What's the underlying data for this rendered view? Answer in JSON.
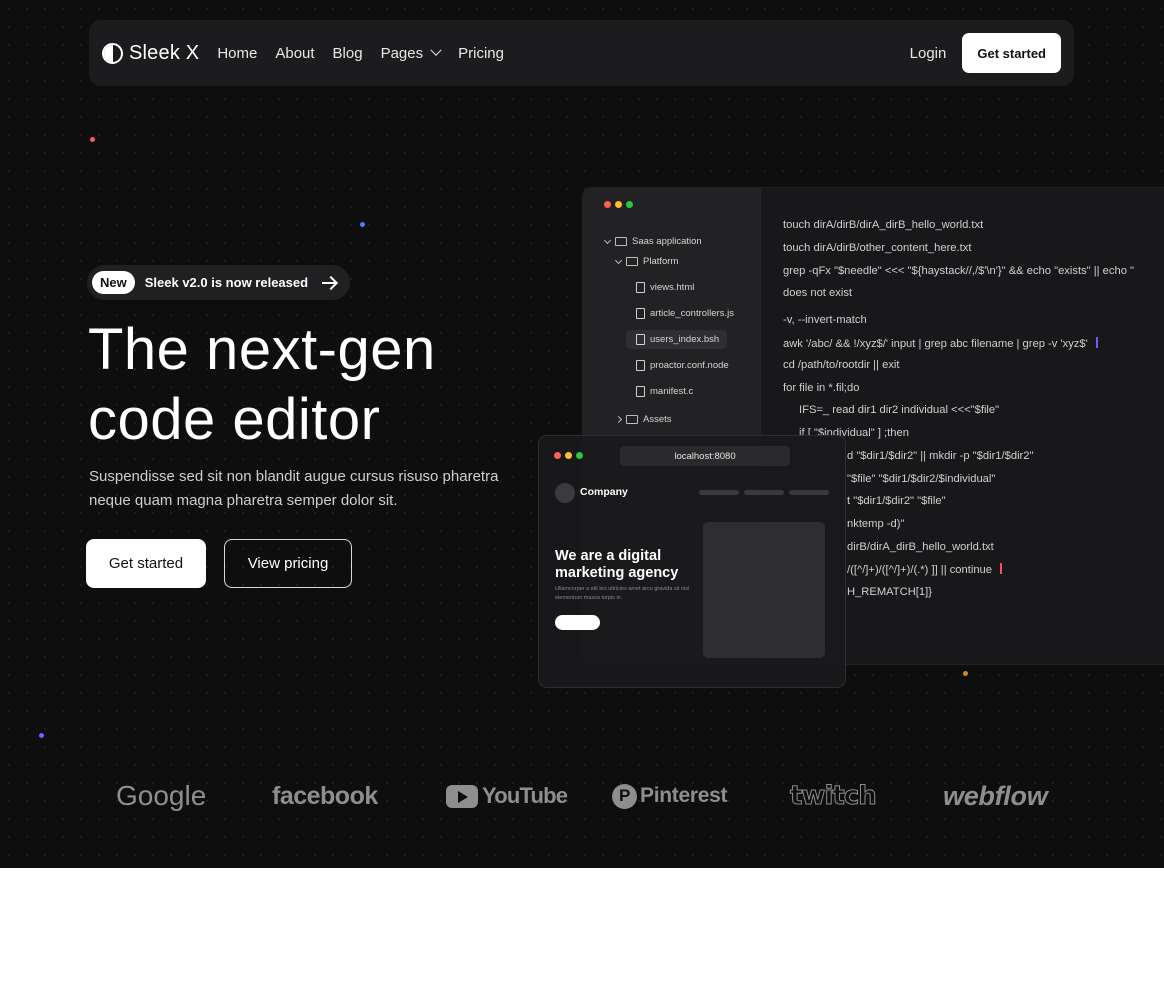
{
  "nav": {
    "logo_text": "Sleek X",
    "links": [
      {
        "label": "Home"
      },
      {
        "label": "About"
      },
      {
        "label": "Blog"
      },
      {
        "label": "Pages"
      },
      {
        "label": "Pricing"
      }
    ],
    "login_label": "Login",
    "cta_label": "Get started"
  },
  "hero": {
    "badge_pill": "New",
    "badge_text": "Sleek v2.0 is now released",
    "headline_line1": "The next-gen",
    "headline_line2": "code editor",
    "subtext": "Suspendisse sed sit non blandit augue cursus risuso pharetra neque quam magna pharetra semper dolor sit.",
    "primary_button": "Get started",
    "secondary_button": "View pricing"
  },
  "editor": {
    "tree": [
      {
        "label": "Saas application",
        "type": "folder"
      },
      {
        "label": "Platform",
        "type": "folder"
      },
      {
        "label": "views.html",
        "type": "file"
      },
      {
        "label": "article_controllers.js",
        "type": "file"
      },
      {
        "label": "users_index.bsh",
        "type": "file",
        "selected": true
      },
      {
        "label": "proactor.conf.node",
        "type": "file"
      },
      {
        "label": "manifest.c",
        "type": "file"
      },
      {
        "label": "Assets",
        "type": "folder"
      }
    ],
    "code": [
      "touch dirA/dirB/dirA_dirB_hello_world.txt",
      "touch dirA/dirB/other_content_here.txt",
      "grep -qFx \"$needle\" <<< \"${haystack//,/$'\\n'}\" && echo \"exists\" || echo \"",
      "does not exist",
      "-v, --invert-match",
      "awk '/abc/ && !/xyz$/' input | grep abc filename | grep -v 'xyz$'",
      "cd /path/to/rootdir || exit",
      "for file in *.fil;do",
      "IFS=_ read dir1 dir2 individual <<<\"$file\"",
      "if [ \"$individual\" ] ;then",
      "d \"$dir1/$dir2\" || mkdir -p \"$dir1/$dir2\"",
      "\"$file\" \"$dir1/$dir2/$individual\"",
      "t \"$dir1/$dir2\" \"$file\"",
      "nktemp -d)\"",
      "dirB/dirA_dirB_hello_world.txt",
      "/([^/]+)/([^/]+)/(.*) ]] || continue",
      "H_REMATCH[1]}"
    ],
    "cursor_colors": [
      "#6b5cff",
      "#ff4d55"
    ]
  },
  "browser": {
    "url": "localhost:8080",
    "company": "Company",
    "title": "We are a digital marketing agency",
    "sub": "Ullamcorper a elit leo ultricies amet arcu gravida sit nisi elementum massa turpis in."
  },
  "logos": [
    {
      "name": "Google"
    },
    {
      "name": "facebook"
    },
    {
      "name": "YouTube"
    },
    {
      "name": "Pinterest"
    },
    {
      "name": "twitch"
    },
    {
      "name": "webflow"
    }
  ],
  "colors": {
    "background": "#0e0e0f",
    "traffic_red": "#ff5f57",
    "traffic_yellow": "#febc2e",
    "traffic_green": "#28c840"
  }
}
